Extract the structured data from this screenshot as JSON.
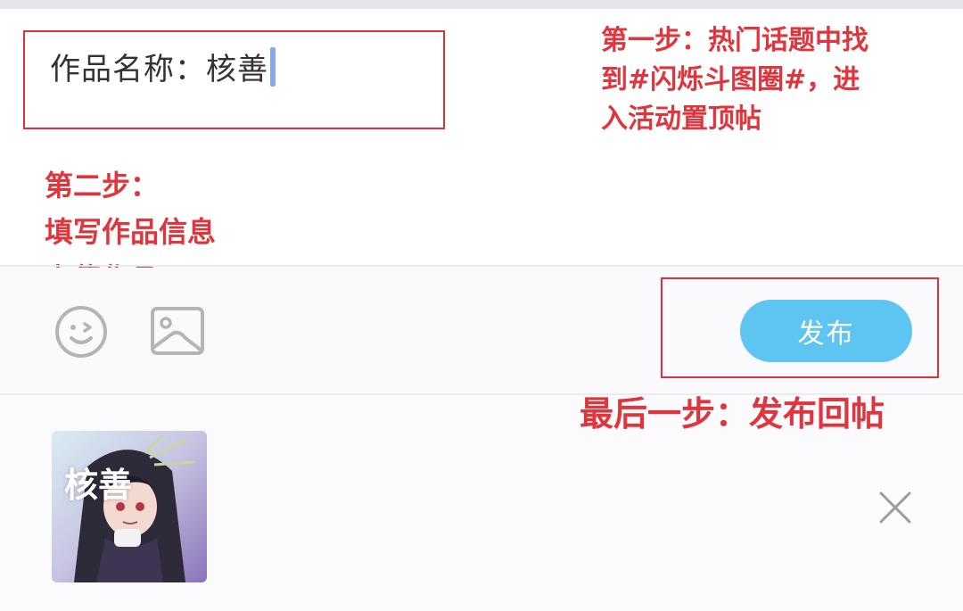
{
  "editor": {
    "title_value": "作品名称：核善"
  },
  "annotations": {
    "step1_lines": [
      "第一步：热门话题中找",
      "到#闪烁斗图圈#，进",
      "入活动置顶帖"
    ],
    "step2_lines": [
      "第二步：",
      "填写作品信息",
      "上传作品"
    ],
    "final_step": "最后一步：发布回帖"
  },
  "toolbar": {
    "emoji_icon": "emoji-icon",
    "image_icon": "image-icon",
    "publish_label": "发布"
  },
  "attachment": {
    "thumbnail_label": "核善",
    "close_icon": "close-icon"
  },
  "colors": {
    "annotation_red": "#e0353d",
    "publish_button": "#5ec4f2",
    "caret": "#8aa6f2",
    "icon_gray": "#b5b5b9"
  }
}
